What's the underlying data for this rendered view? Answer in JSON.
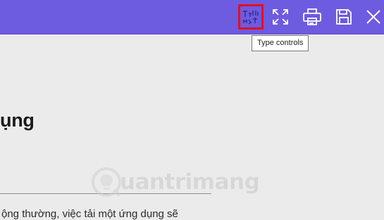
{
  "colors": {
    "toolbar_bg": "#6d5be0",
    "highlight_border": "#e3101b",
    "page_bg": "#ebebeb"
  },
  "toolbar": {
    "buttons": [
      {
        "icon": "type-controls-icon",
        "highlighted": true
      },
      {
        "icon": "fullscreen-icon"
      },
      {
        "icon": "print-icon"
      },
      {
        "icon": "save-icon"
      },
      {
        "icon": "close-icon"
      }
    ]
  },
  "tooltip": {
    "text": "Type controls"
  },
  "document": {
    "heading": "ụng",
    "body": "ộng thường, việc tải một ứng dụng sẽ"
  },
  "watermark": {
    "text": "uantrimang"
  }
}
